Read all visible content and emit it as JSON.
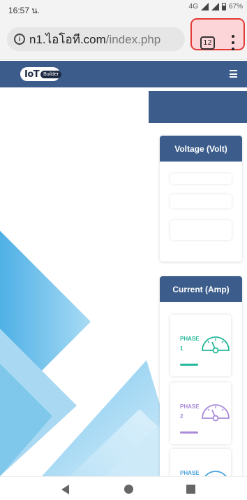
{
  "status_bar": {
    "time": "16:57 น.",
    "network": "4G",
    "battery": "67%"
  },
  "browser": {
    "url_host": "n1.ไอโอที.com",
    "url_path": "/index.php",
    "tab_count": "12",
    "menu_icon": "more-vert-icon",
    "info_icon": "info-icon"
  },
  "site": {
    "logo_main": "IoT",
    "logo_sub": "Builder",
    "menu_icon": "hamburger-icon",
    "colors": {
      "nav": "#3c5d8b",
      "highlight_border": "#e53935",
      "highlight_fill": "#fbd5d8"
    }
  },
  "voltage_card": {
    "title": "Voltage (Volt)"
  },
  "current_card": {
    "title": "Current (Amp)",
    "phases": [
      {
        "label": "PHASE",
        "number": "1",
        "color": "#26b89a"
      },
      {
        "label": "PHASE",
        "number": "2",
        "color": "#a98bd9"
      },
      {
        "label": "PHASE",
        "number": "",
        "color": "#4aa3df"
      }
    ]
  },
  "nav": {
    "back_icon": "back-triangle-icon",
    "home_icon": "home-circle-icon",
    "recent_icon": "recents-square-icon"
  }
}
